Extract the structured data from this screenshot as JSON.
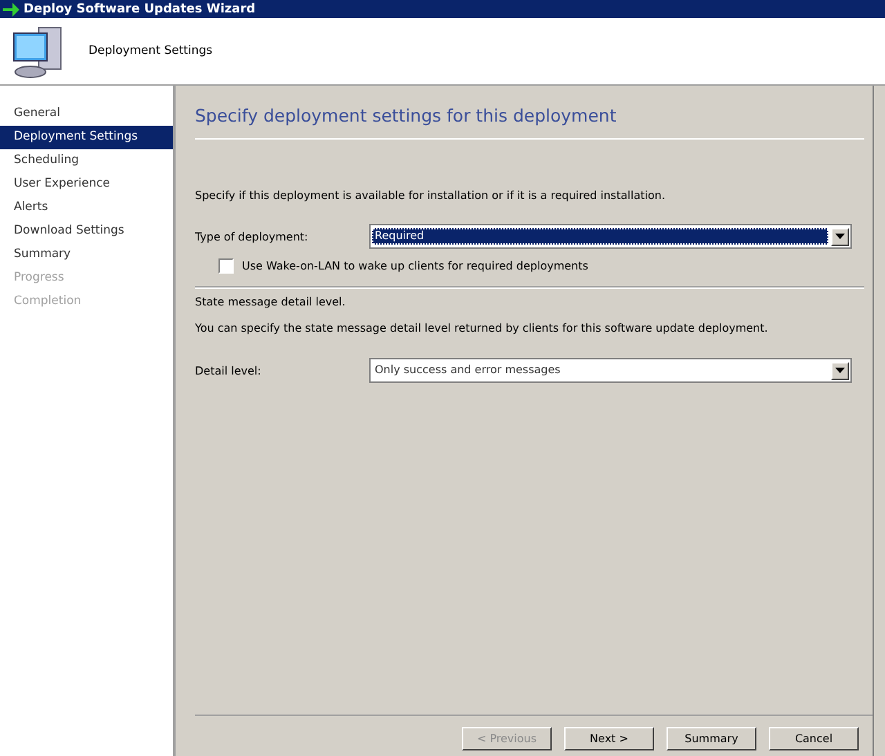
{
  "window": {
    "title": "Deploy Software Updates Wizard"
  },
  "header": {
    "title": "Deployment Settings"
  },
  "sidebar": {
    "items": [
      {
        "label": "General",
        "selected": false,
        "disabled": false
      },
      {
        "label": "Deployment Settings",
        "selected": true,
        "disabled": false
      },
      {
        "label": "Scheduling",
        "selected": false,
        "disabled": false
      },
      {
        "label": "User Experience",
        "selected": false,
        "disabled": false
      },
      {
        "label": "Alerts",
        "selected": false,
        "disabled": false
      },
      {
        "label": "Download Settings",
        "selected": false,
        "disabled": false
      },
      {
        "label": "Summary",
        "selected": false,
        "disabled": false
      },
      {
        "label": "Progress",
        "selected": false,
        "disabled": true
      },
      {
        "label": "Completion",
        "selected": false,
        "disabled": true
      }
    ]
  },
  "page": {
    "heading": "Specify deployment settings for this deployment",
    "intro": "Specify if this deployment is available for installation or if it is a required installation.",
    "type_label": "Type of deployment:",
    "type_value": "Required",
    "type_focused": true,
    "wake_label": "Use Wake-on-LAN to wake up clients for required deployments",
    "wake_checked": false,
    "state_heading": "State message detail level.",
    "state_text": "You can specify the state message detail level returned by clients for this software update deployment.",
    "detail_label": "Detail level:",
    "detail_value": "Only success and error messages"
  },
  "buttons": [
    {
      "label": "< Previous",
      "disabled": true
    },
    {
      "label": "Next >",
      "disabled": false
    },
    {
      "label": "Summary",
      "disabled": false
    },
    {
      "label": "Cancel",
      "disabled": false
    }
  ]
}
